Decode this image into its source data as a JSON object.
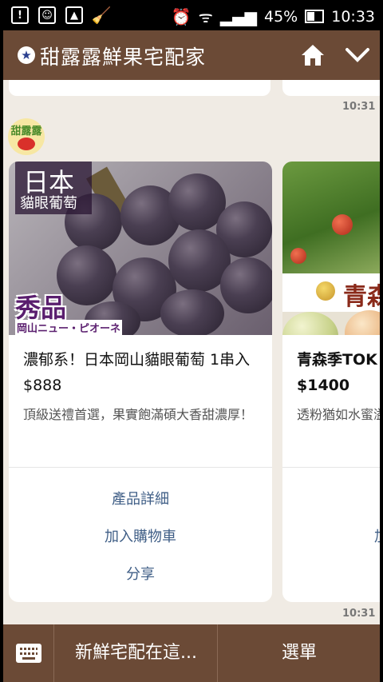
{
  "status_bar": {
    "battery_percent": "45%",
    "time": "10:33"
  },
  "header": {
    "title": "甜露露鮮果宅配家"
  },
  "chat": {
    "timestamp_top": "10:31",
    "timestamp_bottom": "10:31",
    "bot_avatar_text": "甜露露",
    "cards": [
      {
        "image_badge_big": "日本",
        "image_badge_small": "貓眼葡萄",
        "image_grade": "秀品",
        "image_grade_sub": "岡山ニュー・ピオーネ",
        "title": "濃郁系！日本岡山貓眼葡萄 1串入 $888",
        "description": "頂級送禮首選，果實飽滿碩大香甜濃厚！",
        "actions": [
          "產品詳細",
          "加入購物車",
          "分享"
        ]
      },
      {
        "image_banner": "青森",
        "title": "青森季TOK $1400",
        "description": "透粉猶如水蜜溢",
        "actions": [
          "加"
        ]
      }
    ]
  },
  "bottom_bar": {
    "left_menu": "新鮮宅配在這...",
    "right_menu": "選單"
  },
  "colors": {
    "brand_brown": "#6b4a36",
    "chat_background": "#f0ebe4",
    "action_text": "#3f5e86"
  }
}
